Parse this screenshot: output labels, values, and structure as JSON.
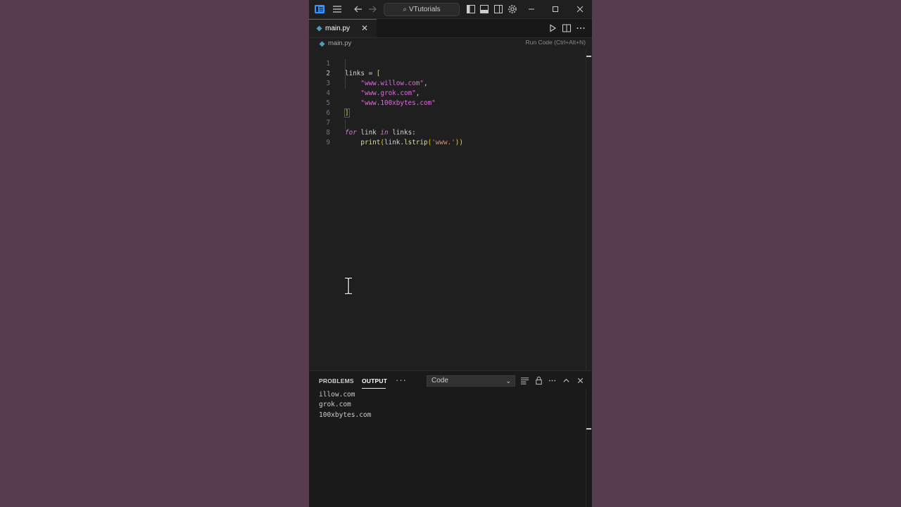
{
  "titlebar": {
    "search_text": "VTutorials",
    "icons": [
      "vscode-logo-icon",
      "menu-icon",
      "back-arrow-icon",
      "forward-arrow-icon",
      "search-icon",
      "toggle-primary-sidebar-icon",
      "toggle-panel-icon",
      "toggle-secondary-sidebar-icon",
      "settings-gear-icon",
      "minimize-icon",
      "maximize-icon",
      "close-icon"
    ]
  },
  "tab": {
    "label": "main.py",
    "close": "✕"
  },
  "breadcrumb": {
    "file": "main.py"
  },
  "editor_actions": {
    "tooltip": "Run Code (Ctrl+Alt+N)"
  },
  "code": {
    "active_line": 2,
    "lines": [
      {
        "n": "1",
        "text": "links = ["
      },
      {
        "n": "2",
        "text": "    \"www.willow.com\","
      },
      {
        "n": "3",
        "text": "    \"www.grok.com\","
      },
      {
        "n": "4",
        "text": "    \"www.100xbytes.com\""
      },
      {
        "n": "5",
        "text": "]"
      },
      {
        "n": "6",
        "text": ""
      },
      {
        "n": "7",
        "text": "for link in links:"
      },
      {
        "n": "8",
        "text": "    print(link.lstrip('www.'))"
      },
      {
        "n": "9",
        "text": ""
      }
    ]
  },
  "panel": {
    "tab_problems": "PROBLEMS",
    "tab_output": "OUTPUT",
    "more": "···",
    "channel_select": "Code",
    "output_lines": [
      "illow.com",
      "grok.com",
      "100xbytes.com"
    ]
  },
  "colors": {
    "background": "#563c4c",
    "editor_bg": "#1f1f1f",
    "accent": "#0078d4"
  }
}
